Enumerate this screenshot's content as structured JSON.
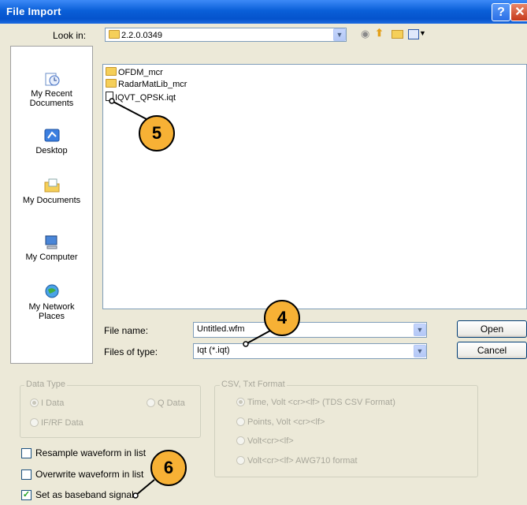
{
  "window": {
    "title": "File Import",
    "help_glyph": "?",
    "close_glyph": "✕"
  },
  "look_in": {
    "label": "Look in:",
    "value": "2.2.0.0349"
  },
  "places": [
    {
      "label": "My Recent Documents",
      "icon": "recent-documents-icon"
    },
    {
      "label": "Desktop",
      "icon": "desktop-icon"
    },
    {
      "label": "My Documents",
      "icon": "my-documents-icon"
    },
    {
      "label": "My Computer",
      "icon": "my-computer-icon"
    },
    {
      "label": "My Network Places",
      "icon": "network-places-icon"
    }
  ],
  "files": [
    {
      "name": "OFDM_mcr",
      "type": "folder"
    },
    {
      "name": "RadarMatLib_mcr",
      "type": "folder"
    },
    {
      "name": "IQVT_QPSK.iqt",
      "type": "file"
    }
  ],
  "file_name": {
    "label": "File name:",
    "value": "Untitled.wfm"
  },
  "files_of_type": {
    "label": "Files of type:",
    "value": "Iqt (*.iqt)"
  },
  "buttons": {
    "open": "Open",
    "cancel": "Cancel"
  },
  "data_type": {
    "legend": "Data Type",
    "options": [
      "I Data",
      "Q Data",
      "IF/RF Data"
    ],
    "selected": "I Data"
  },
  "csv_format": {
    "legend": "CSV, Txt Format",
    "options": [
      "Time, Volt <cr><lf> (TDS CSV Format)",
      "Points, Volt <cr><lf>",
      "Volt<cr><lf>",
      "Volt<cr><lf> AWG710 format"
    ],
    "selected": "Time, Volt <cr><lf> (TDS CSV Format)"
  },
  "checkboxes": [
    {
      "label": "Resample waveform in list",
      "checked": false
    },
    {
      "label": "Overwrite waveform in list",
      "checked": false
    },
    {
      "label": "Set as baseband signal",
      "checked": true
    }
  ],
  "callouts": [
    "5",
    "4",
    "6"
  ],
  "colors": {
    "titlebar": "#0a5fd8",
    "callout": "#f7b135",
    "dialog_bg": "#ece9d8"
  }
}
